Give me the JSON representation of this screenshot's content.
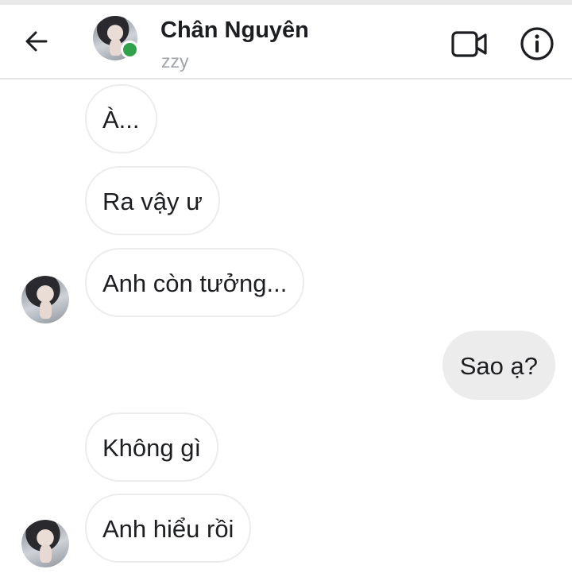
{
  "header": {
    "contact_name": "Chân Nguyên",
    "contact_subtitle": "zzy",
    "online_color": "#31a24c",
    "icons": [
      "back-arrow-icon",
      "video-call-icon",
      "info-icon"
    ]
  },
  "messages": [
    {
      "direction": "incoming",
      "text": "À..."
    },
    {
      "direction": "incoming",
      "text": "Ra vậy ư"
    },
    {
      "direction": "incoming",
      "text": "Anh còn tưởng..."
    },
    {
      "direction": "outgoing",
      "text": "Sao ạ?"
    },
    {
      "direction": "incoming",
      "text": "Không gì"
    },
    {
      "direction": "incoming",
      "text": "Anh hiểu rồi"
    }
  ]
}
